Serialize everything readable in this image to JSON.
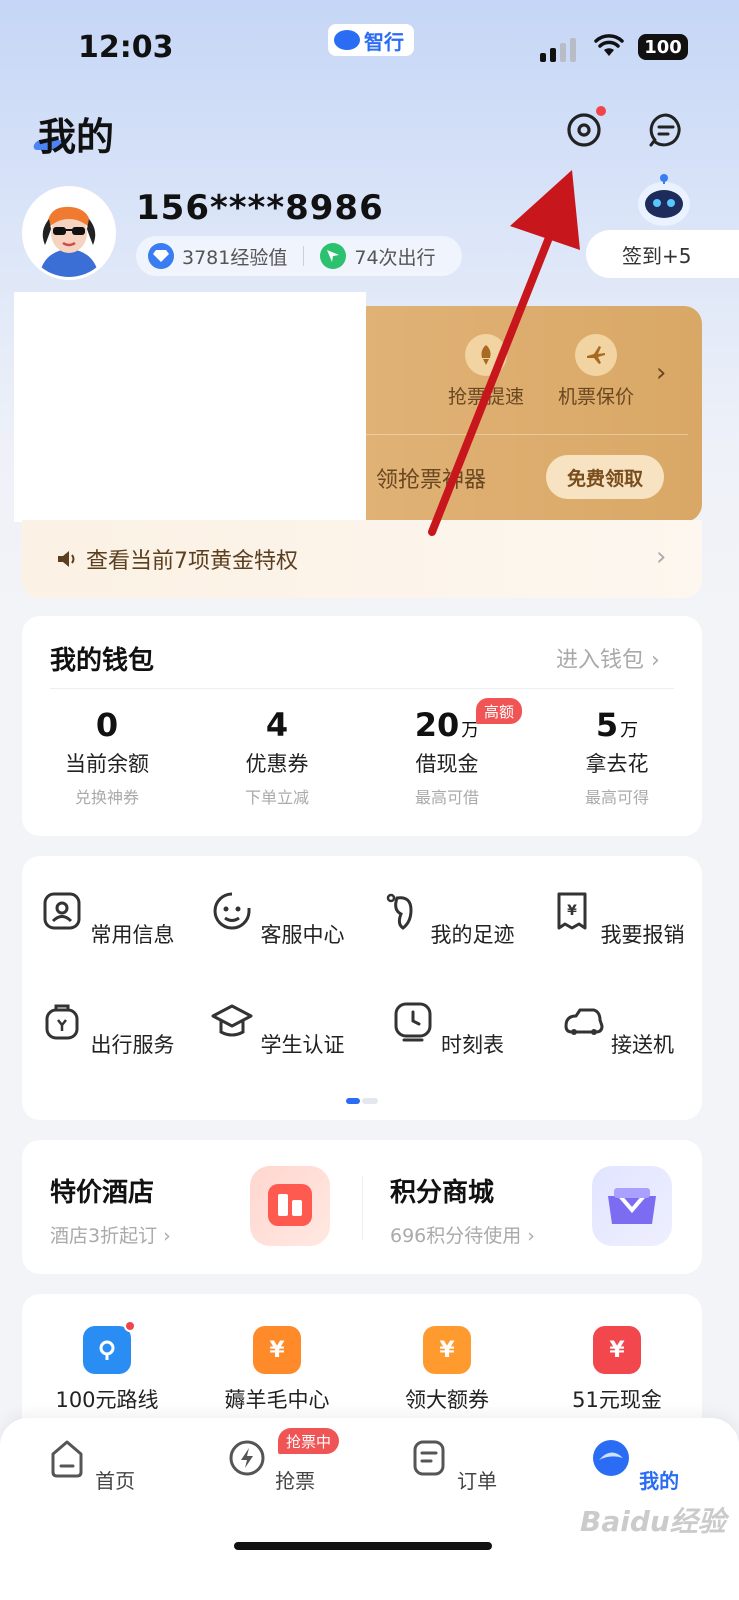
{
  "status_bar": {
    "time": "12:03",
    "app_name": "智行",
    "battery": "100"
  },
  "header": {
    "title": "我的"
  },
  "profile": {
    "phone": "156****8986",
    "exp": "3781经验值",
    "trips": "74次出行",
    "sign_in": "签到+5"
  },
  "membership": {
    "perks": [
      "抢票提速",
      "机票保价"
    ],
    "tool_label": "领抢票神器",
    "free_button": "免费领取",
    "privileges_text": "查看当前7项黄金特权"
  },
  "wallet": {
    "title": "我的钱包",
    "enter_link": "进入钱包",
    "hot_badge": "高额",
    "items": [
      {
        "value": "0",
        "unit": "",
        "label": "当前余额",
        "sub": "兑换神券"
      },
      {
        "value": "4",
        "unit": "",
        "label": "优惠券",
        "sub": "下单立减"
      },
      {
        "value": "20",
        "unit": "万",
        "label": "借现金",
        "sub": "最高可借"
      },
      {
        "value": "5",
        "unit": "万",
        "label": "拿去花",
        "sub": "最高可得"
      }
    ]
  },
  "services": {
    "items": [
      {
        "label": "常用信息",
        "icon": "id-card-icon"
      },
      {
        "label": "客服中心",
        "icon": "customer-service-icon"
      },
      {
        "label": "我的足迹",
        "icon": "footprint-icon"
      },
      {
        "label": "我要报销",
        "icon": "receipt-icon"
      },
      {
        "label": "出行服务",
        "icon": "travel-bag-icon"
      },
      {
        "label": "学生认证",
        "icon": "graduation-cap-icon"
      },
      {
        "label": "时刻表",
        "icon": "clock-icon"
      },
      {
        "label": "接送机",
        "icon": "car-icon"
      }
    ]
  },
  "promos": {
    "hotel": {
      "title": "特价酒店",
      "sub": "酒店3折起订"
    },
    "mall": {
      "title": "积分商城",
      "sub": "696积分待使用"
    }
  },
  "quick": {
    "items": [
      {
        "label": "100元路线",
        "icon": "location-pin-icon"
      },
      {
        "label": "薅羊毛中心",
        "icon": "yuan-icon"
      },
      {
        "label": "领大额券",
        "icon": "gift-icon"
      },
      {
        "label": "51元现金",
        "icon": "cash-icon"
      }
    ]
  },
  "tabbar": {
    "badge": "抢票中",
    "tabs": [
      "首页",
      "抢票",
      "订单",
      "我的"
    ]
  },
  "watermark": "Baidu经验"
}
